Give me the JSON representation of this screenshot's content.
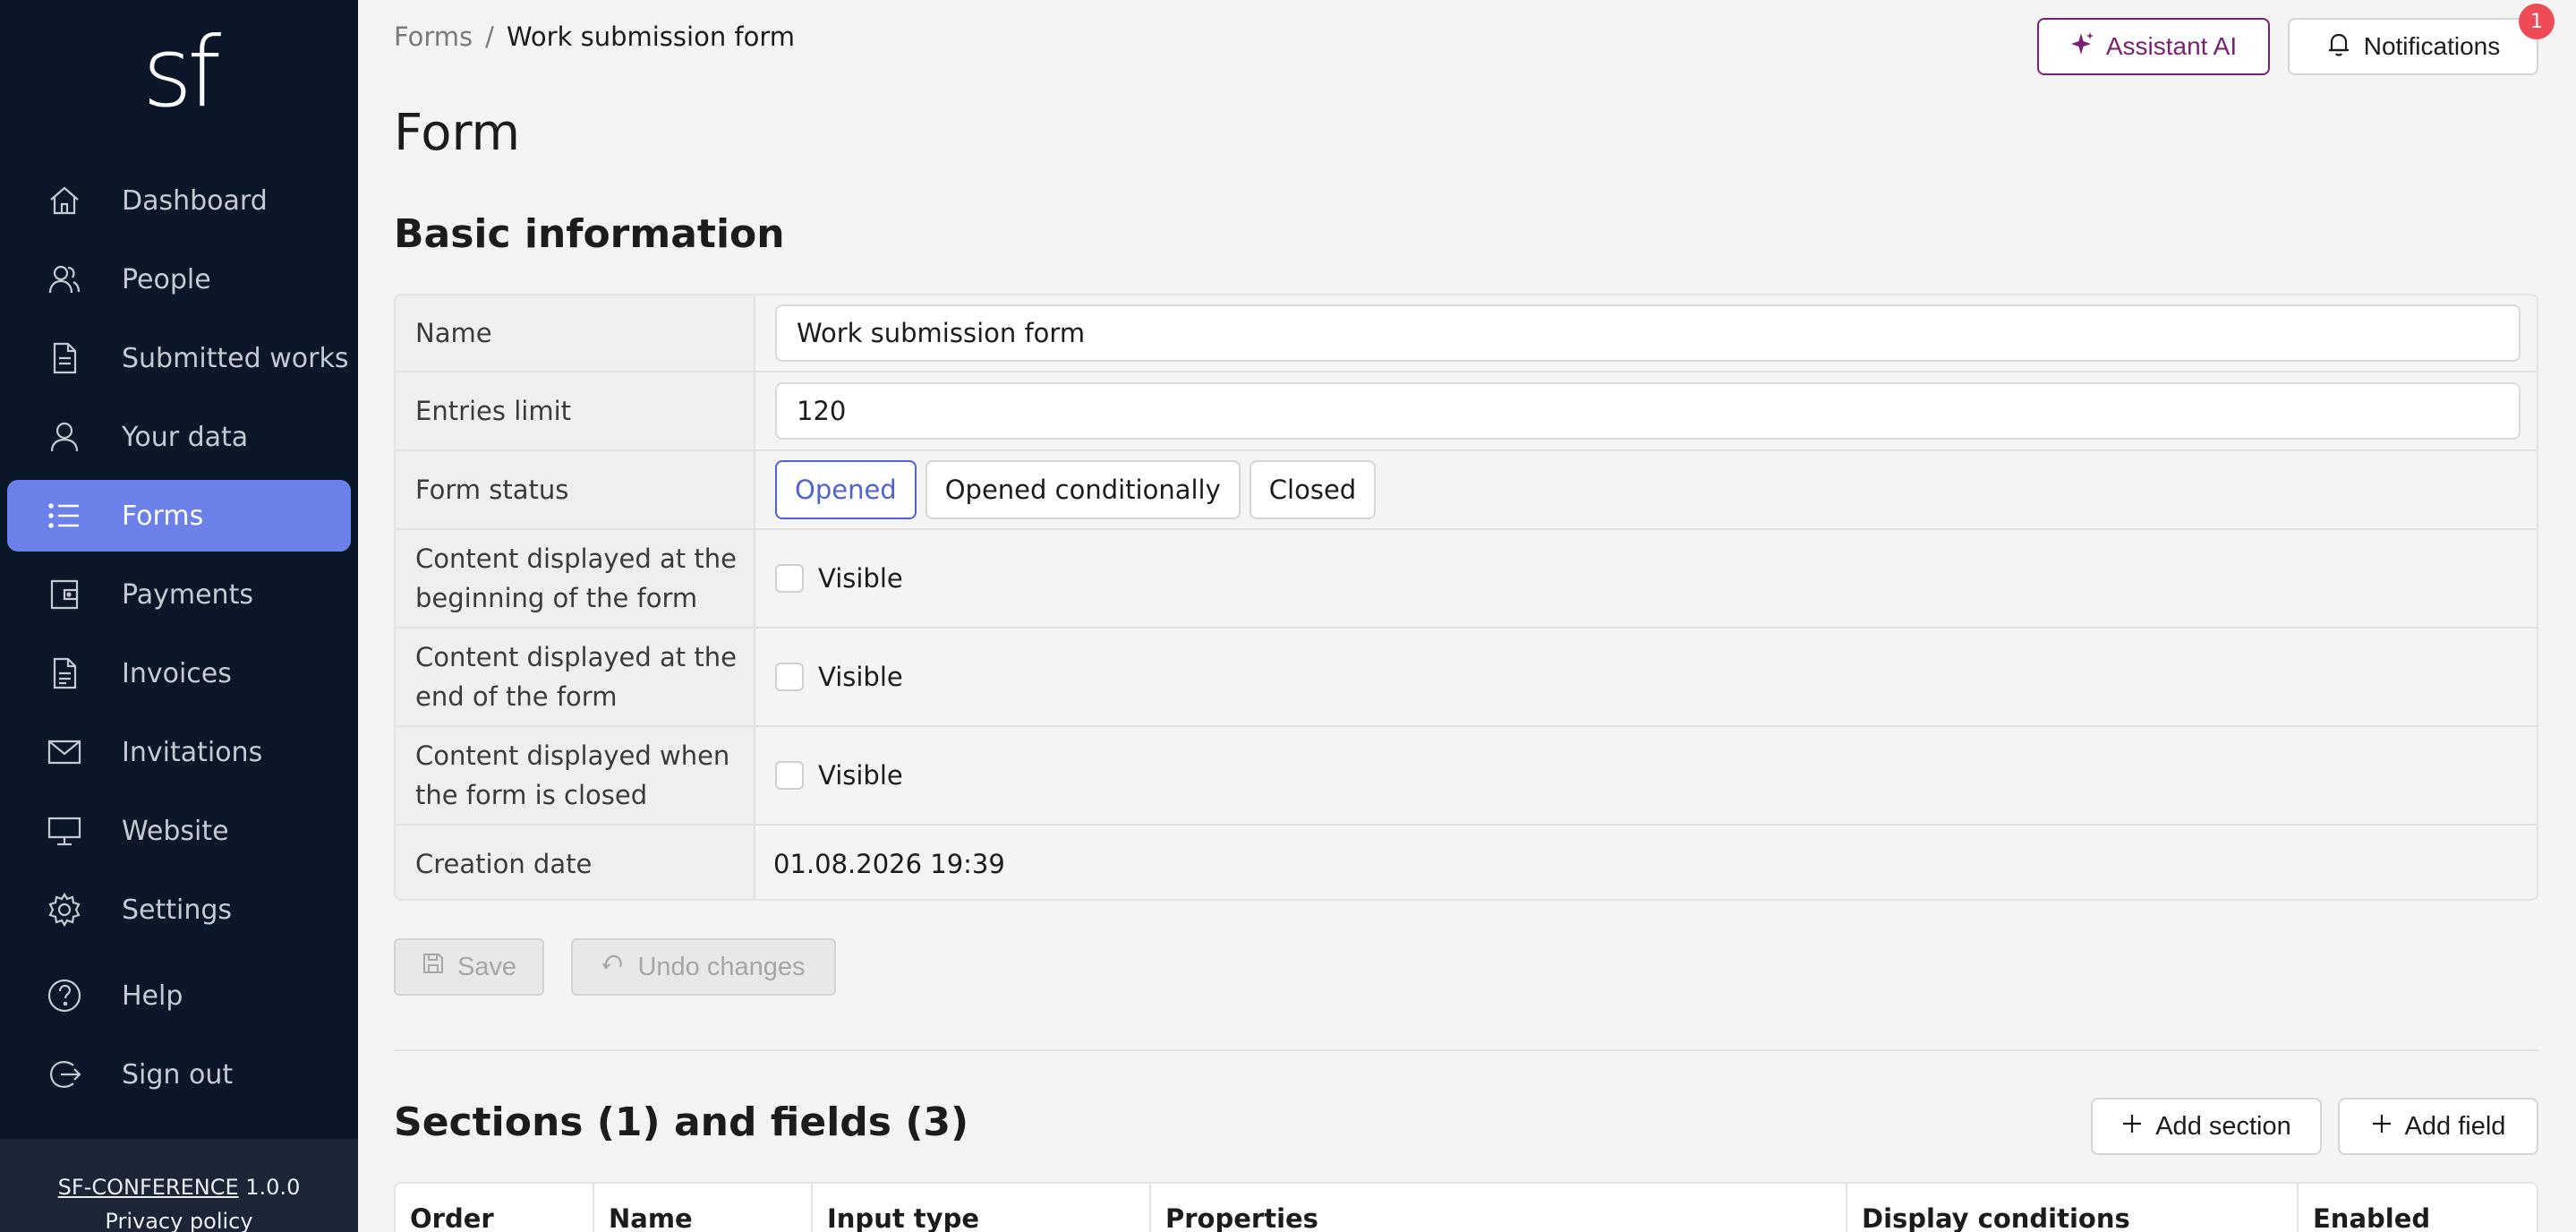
{
  "sidebar": {
    "logo": "sf",
    "items": [
      {
        "label": "Dashboard",
        "icon": "home-icon"
      },
      {
        "label": "People",
        "icon": "people-icon"
      },
      {
        "label": "Submitted works",
        "icon": "document-icon"
      },
      {
        "label": "Your data",
        "icon": "user-icon"
      },
      {
        "label": "Forms",
        "icon": "list-icon",
        "active": true
      },
      {
        "label": "Payments",
        "icon": "wallet-icon"
      },
      {
        "label": "Invoices",
        "icon": "invoice-icon"
      },
      {
        "label": "Invitations",
        "icon": "mail-icon"
      },
      {
        "label": "Website",
        "icon": "monitor-icon"
      },
      {
        "label": "Settings",
        "icon": "gear-icon"
      },
      {
        "label": "Help",
        "icon": "help-icon"
      },
      {
        "label": "Sign out",
        "icon": "sign-out-icon"
      }
    ],
    "footer": {
      "app_name": "SF-CONFERENCE",
      "version": "1.0.0",
      "privacy": "Privacy policy"
    }
  },
  "breadcrumb": {
    "parent": "Forms",
    "separator": "/",
    "current": "Work submission form"
  },
  "header": {
    "assistant_label": "Assistant AI",
    "notifications_label": "Notifications",
    "notifications_count": "1"
  },
  "page": {
    "title": "Form"
  },
  "basic": {
    "title": "Basic information",
    "name_label": "Name",
    "name_value": "Work submission form",
    "limit_label": "Entries limit",
    "limit_value": "120",
    "status_label": "Form status",
    "status_options": [
      "Opened",
      "Opened conditionally",
      "Closed"
    ],
    "status_selected": "Opened",
    "content_begin_label": "Content displayed at the beginning of the form",
    "content_end_label": "Content displayed at the end of the form",
    "content_closed_label": "Content displayed when the form is closed",
    "visible_label": "Visible",
    "creation_label": "Creation date",
    "creation_value": "01.08.2026 19:39"
  },
  "actions": {
    "save_label": "Save",
    "undo_label": "Undo changes"
  },
  "sections": {
    "title": "Sections (1) and fields (3)",
    "add_section_label": "Add section",
    "add_field_label": "Add field",
    "columns": [
      "Order",
      "Name",
      "Input type",
      "Properties",
      "Display conditions",
      "Enabled"
    ]
  },
  "colors": {
    "sidebar_bg": "#0b1729",
    "active_nav": "#6b80e8",
    "assistant_accent": "#7b1f74",
    "selected_status": "#4f63d6",
    "badge": "#ee4b57"
  }
}
